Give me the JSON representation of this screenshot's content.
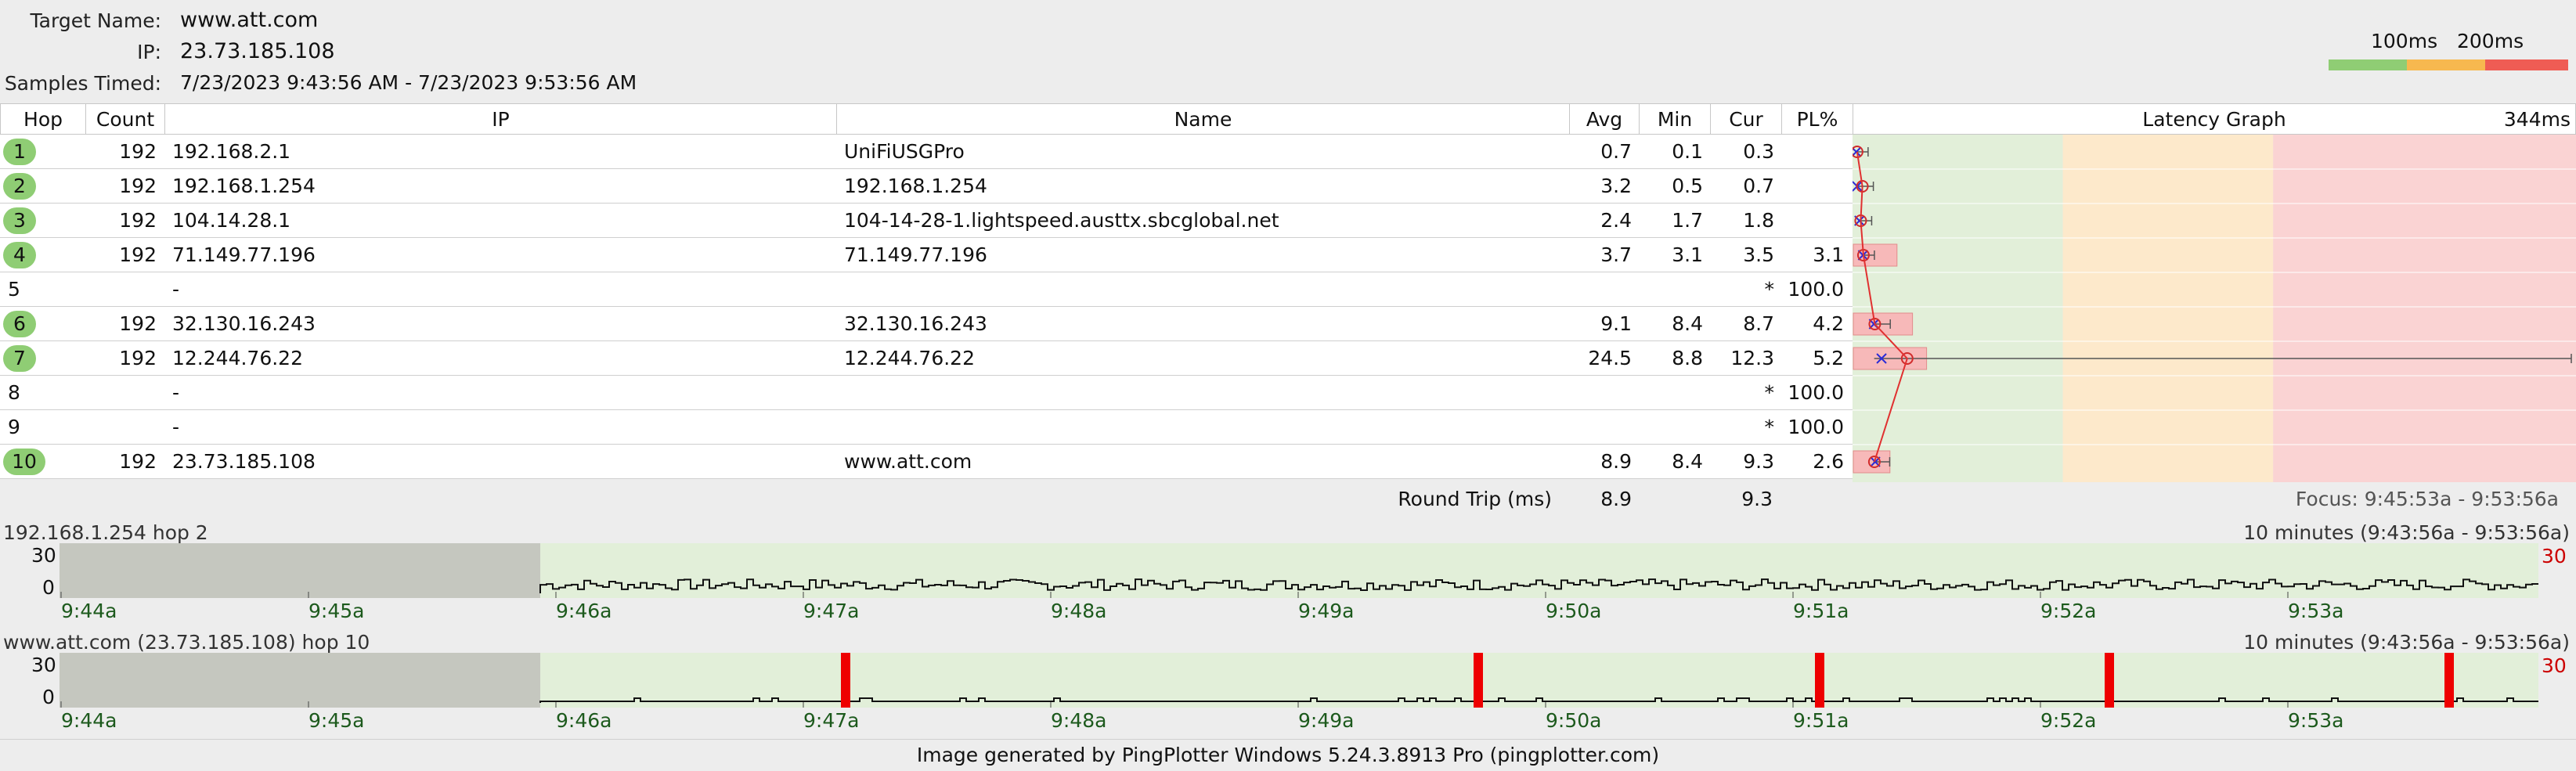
{
  "header": {
    "target_label": "Target Name:",
    "target_value": "www.att.com",
    "ip_label": "IP:",
    "ip_value": "23.73.185.108",
    "samples_label": "Samples Timed:",
    "samples_value": "7/23/2023 9:43:56 AM - 7/23/2023 9:53:56 AM",
    "legend_100": "100ms",
    "legend_200": "200ms",
    "legend_colors": [
      "#8fcd74",
      "#f7b84f",
      "#ef5c54"
    ]
  },
  "table": {
    "columns": [
      "Hop",
      "Count",
      "IP",
      "Name",
      "Avg",
      "Min",
      "Cur",
      "PL%"
    ],
    "graph_header": "Latency Graph",
    "graph_max": "344ms",
    "rows": [
      {
        "hop": "1",
        "count": "192",
        "ip": "192.168.2.1",
        "name": "UniFiUSGPro",
        "avg": "0.7",
        "min": "0.1",
        "cur": "0.3",
        "pl": "",
        "ok": true
      },
      {
        "hop": "2",
        "count": "192",
        "ip": "192.168.1.254",
        "name": "192.168.1.254",
        "avg": "3.2",
        "min": "0.5",
        "cur": "0.7",
        "pl": "",
        "ok": true
      },
      {
        "hop": "3",
        "count": "192",
        "ip": "104.14.28.1",
        "name": "104-14-28-1.lightspeed.austtx.sbcglobal.net",
        "avg": "2.4",
        "min": "1.7",
        "cur": "1.8",
        "pl": "",
        "ok": true
      },
      {
        "hop": "4",
        "count": "192",
        "ip": "71.149.77.196",
        "name": "71.149.77.196",
        "avg": "3.7",
        "min": "3.1",
        "cur": "3.5",
        "pl": "3.1",
        "ok": true
      },
      {
        "hop": "5",
        "count": "",
        "ip": "-",
        "name": "",
        "avg": "",
        "min": "",
        "cur": "*",
        "pl": "100.0",
        "ok": false
      },
      {
        "hop": "6",
        "count": "192",
        "ip": "32.130.16.243",
        "name": "32.130.16.243",
        "avg": "9.1",
        "min": "8.4",
        "cur": "8.7",
        "pl": "4.2",
        "ok": true
      },
      {
        "hop": "7",
        "count": "192",
        "ip": "12.244.76.22",
        "name": "12.244.76.22",
        "avg": "24.5",
        "min": "8.8",
        "cur": "12.3",
        "pl": "5.2",
        "ok": true
      },
      {
        "hop": "8",
        "count": "",
        "ip": "-",
        "name": "",
        "avg": "",
        "min": "",
        "cur": "*",
        "pl": "100.0",
        "ok": false
      },
      {
        "hop": "9",
        "count": "",
        "ip": "-",
        "name": "",
        "avg": "",
        "min": "",
        "cur": "*",
        "pl": "100.0",
        "ok": false
      },
      {
        "hop": "10",
        "count": "192",
        "ip": "23.73.185.108",
        "name": "www.att.com",
        "avg": "8.9",
        "min": "8.4",
        "cur": "9.3",
        "pl": "2.6",
        "ok": true
      }
    ],
    "summary_label": "Round Trip (ms)",
    "summary_avg": "8.9",
    "summary_cur": "9.3",
    "focus": "Focus: 9:45:53a - 9:53:56a"
  },
  "timeline1": {
    "title": "192.168.1.254 hop 2",
    "range": "10 minutes (9:43:56a - 9:53:56a)",
    "y_top": "30",
    "y_bottom": "0",
    "max_label": "30",
    "ticks": [
      "9:44a",
      "9:45a",
      "9:46a",
      "9:47a",
      "9:48a",
      "9:49a",
      "9:50a",
      "9:51a",
      "9:52a",
      "9:53a"
    ]
  },
  "timeline2": {
    "title": "www.att.com (23.73.185.108) hop 10",
    "range": "10 minutes (9:43:56a - 9:53:56a)",
    "y_top": "30",
    "y_bottom": "0",
    "max_label": "30",
    "ticks": [
      "9:44a",
      "9:45a",
      "9:46a",
      "9:47a",
      "9:48a",
      "9:49a",
      "9:50a",
      "9:51a",
      "9:52a",
      "9:53a"
    ]
  },
  "footer": "Image generated by PingPlotter Windows 5.24.3.8913 Pro (pingplotter.com)"
}
